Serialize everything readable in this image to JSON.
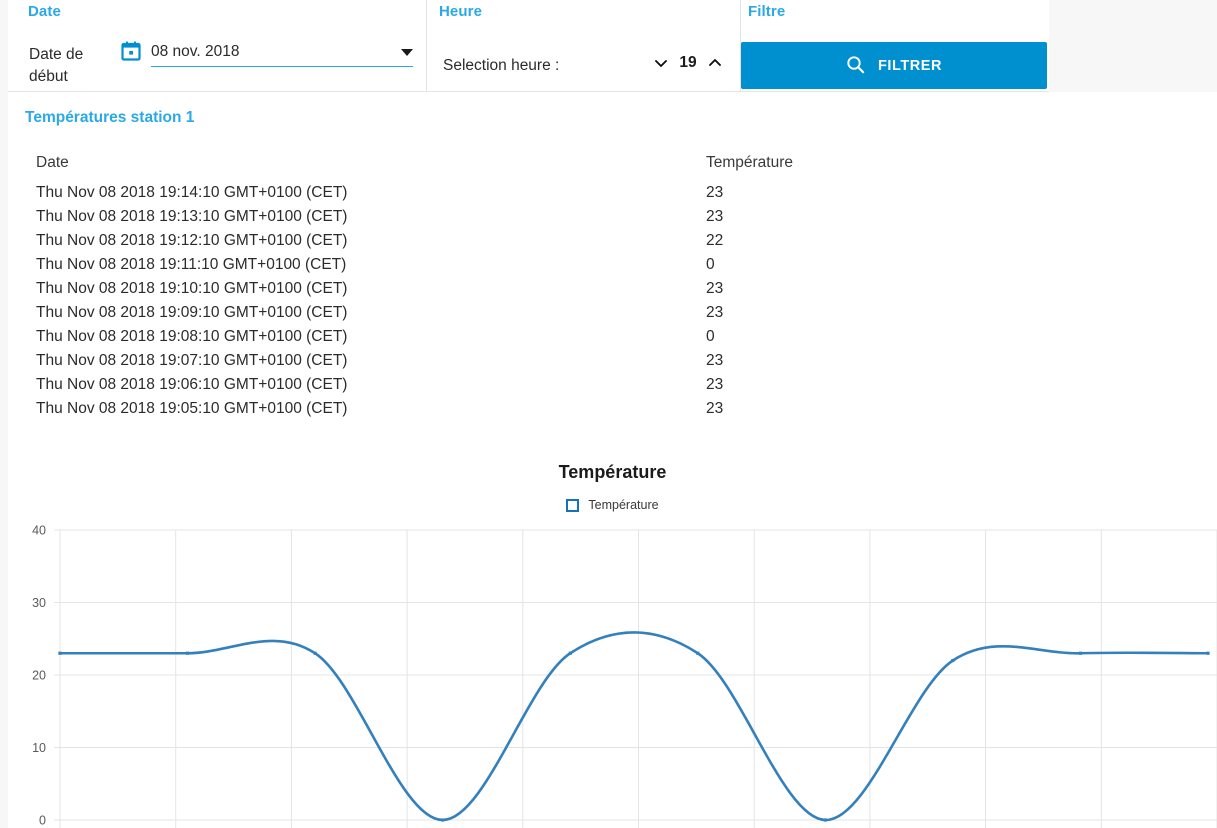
{
  "toolbar": {
    "date": {
      "section_title": "Date",
      "field_label": "Date de début",
      "value": "08 nov. 2018",
      "icon": "calendar-icon",
      "caret_icon": "dropdown-caret-icon"
    },
    "heure": {
      "section_title": "Heure",
      "field_label": "Selection heure :",
      "value": "19",
      "down_icon": "chevron-down-icon",
      "up_icon": "chevron-up-icon"
    },
    "filtre": {
      "section_title": "Filtre",
      "button_label": "FILTRER",
      "button_icon": "search-icon",
      "button_color": "#0090d0"
    }
  },
  "content": {
    "station_title": "Températures station 1",
    "table": {
      "columns": [
        "Date",
        "Température"
      ],
      "rows": [
        [
          "Thu Nov 08 2018 19:14:10 GMT+0100 (CET)",
          "23"
        ],
        [
          "Thu Nov 08 2018 19:13:10 GMT+0100 (CET)",
          "23"
        ],
        [
          "Thu Nov 08 2018 19:12:10 GMT+0100 (CET)",
          "22"
        ],
        [
          "Thu Nov 08 2018 19:11:10 GMT+0100 (CET)",
          "0"
        ],
        [
          "Thu Nov 08 2018 19:10:10 GMT+0100 (CET)",
          "23"
        ],
        [
          "Thu Nov 08 2018 19:09:10 GMT+0100 (CET)",
          "23"
        ],
        [
          "Thu Nov 08 2018 19:08:10 GMT+0100 (CET)",
          "0"
        ],
        [
          "Thu Nov 08 2018 19:07:10 GMT+0100 (CET)",
          "23"
        ],
        [
          "Thu Nov 08 2018 19:06:10 GMT+0100 (CET)",
          "23"
        ],
        [
          "Thu Nov 08 2018 19:05:10 GMT+0100 (CET)",
          "23"
        ]
      ]
    }
  },
  "chart_data": {
    "type": "line",
    "title": "Température",
    "xlabel": "",
    "ylabel": "",
    "legend": [
      "Température"
    ],
    "legend_position": "top-center",
    "grid": true,
    "ylim": [
      0,
      40
    ],
    "yticks": [
      0,
      10,
      20,
      30,
      40
    ],
    "series": [
      {
        "name": "Température",
        "color": "#3380bd",
        "values": [
          23,
          23,
          23,
          0,
          23,
          23,
          0,
          22,
          23,
          23
        ]
      }
    ],
    "x": [
      "Thu Nov 08 2018 19:05:10 GMT+0100 (CET)",
      "Thu Nov 08 2018 19:06:10 GMT+0100 (CET)",
      "Thu Nov 08 2018 19:07:10 GMT+0100 (CET)",
      "Thu Nov 08 2018 19:08:10 GMT+0100 (CET)",
      "Thu Nov 08 2018 19:09:10 GMT+0100 (CET)",
      "Thu Nov 08 2018 19:10:10 GMT+0100 (CET)",
      "Thu Nov 08 2018 19:11:10 GMT+0100 (CET)",
      "Thu Nov 08 2018 19:12:10 GMT+0100 (CET)",
      "Thu Nov 08 2018 19:13:10 GMT+0100 (CET)",
      "Thu Nov 08 2018 19:14:10 GMT+0100 (CET)"
    ],
    "xticklabels": [
      "",
      "",
      "",
      "",
      "",
      "",
      "",
      "",
      "",
      "",
      ""
    ],
    "smoothing": "spline"
  }
}
